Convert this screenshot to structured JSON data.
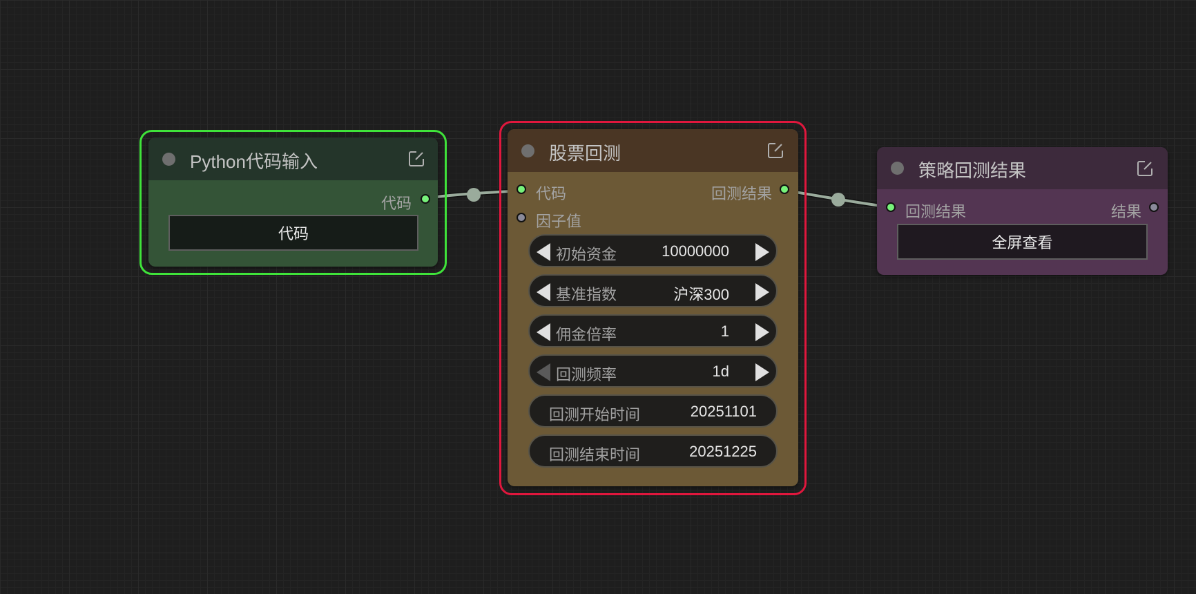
{
  "nodes": {
    "python_input": {
      "title": "Python代码输入",
      "output_label": "代码",
      "button_label": "代码",
      "header_color": "#24352a",
      "body_color": "#345437",
      "selection_color": "#3fe33a"
    },
    "backtest": {
      "title": "股票回测",
      "inputs": [
        "代码",
        "因子值"
      ],
      "output_label": "回测结果",
      "header_color": "#4a3624",
      "body_color": "#6c5936",
      "selection_color": "#e0173d",
      "widgets": [
        {
          "label": "初始资金",
          "value": "10000000"
        },
        {
          "label": "基准指数",
          "value": "沪深300"
        },
        {
          "label": "佣金倍率",
          "value": "1"
        },
        {
          "label": "回测频率",
          "value": "1d"
        },
        {
          "label": "回测开始时间",
          "value": "20251101"
        },
        {
          "label": "回测结束时间",
          "value": "20251225"
        }
      ]
    },
    "result": {
      "title": "策略回测结果",
      "input_label": "回测结果",
      "output_label": "结果",
      "button_label": "全屏查看",
      "header_color": "#3d2a3c",
      "body_color": "#533552"
    }
  },
  "colors": {
    "canvas": "#1e1e1e",
    "link": "#9aab9c",
    "slot_connected": "#77f27a",
    "slot_unconnected": "#8a8a9a"
  },
  "icons": {
    "edit": "edit-icon",
    "status": "status-dot-icon"
  }
}
